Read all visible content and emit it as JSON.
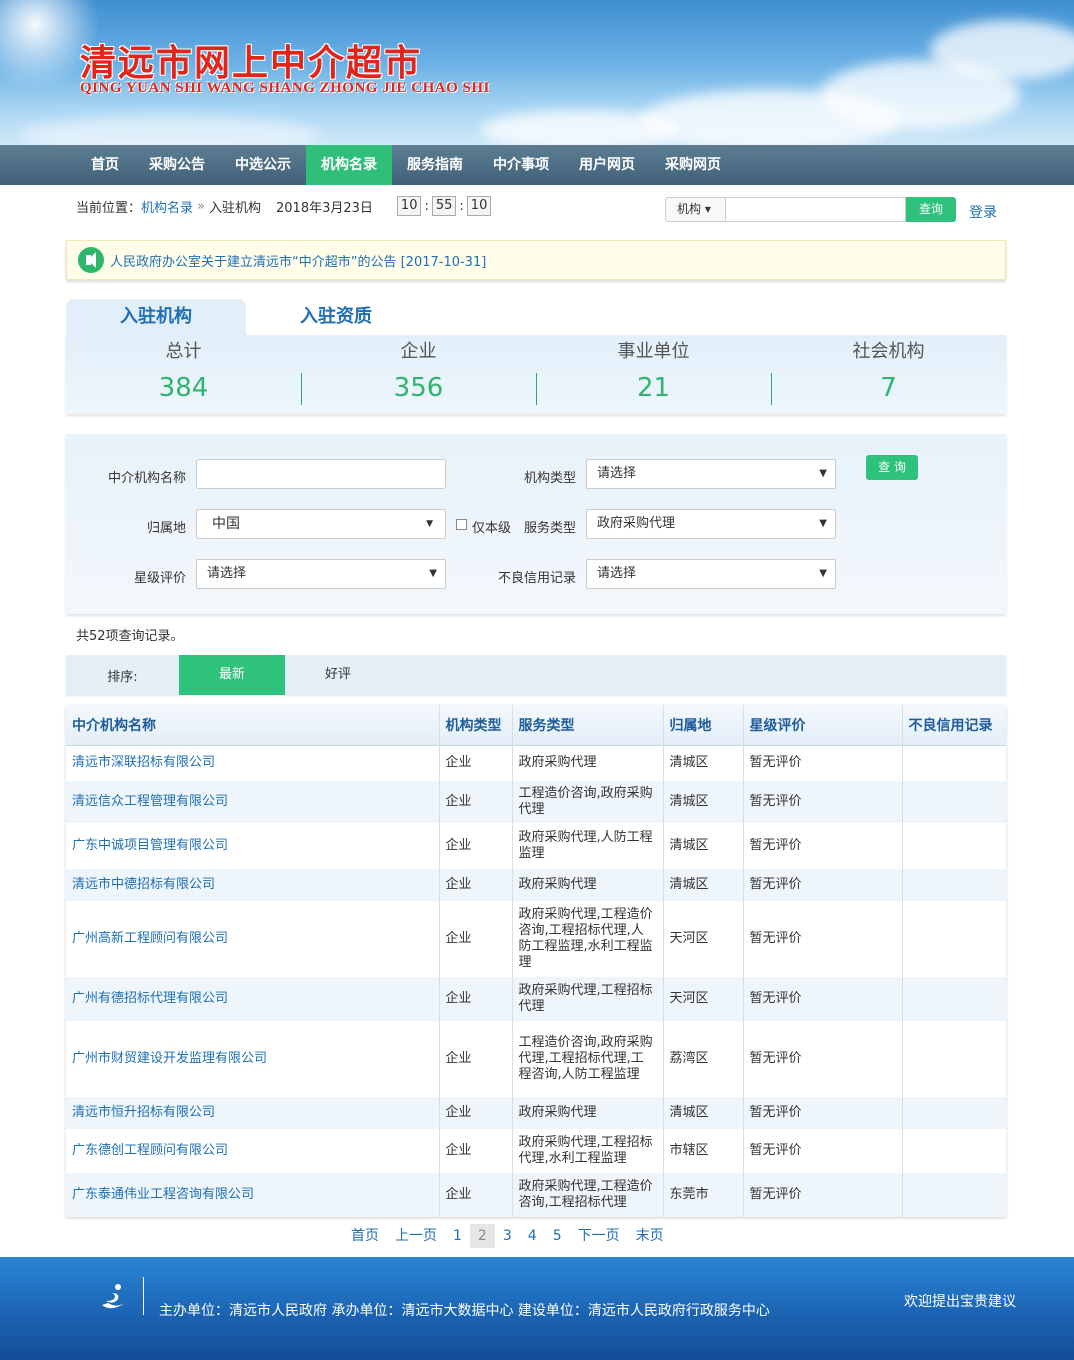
{
  "header": {
    "title": "清远市网上中介超市",
    "subtitle": "QING YUAN SHI WANG SHANG ZHONG JIE CHAO SHI"
  },
  "nav": [
    {
      "label": "首页",
      "active": false
    },
    {
      "label": "采购公告",
      "active": false
    },
    {
      "label": "中选公示",
      "active": false
    },
    {
      "label": "机构名录",
      "active": true
    },
    {
      "label": "服务指南",
      "active": false
    },
    {
      "label": "中介事项",
      "active": false
    },
    {
      "label": "用户网页",
      "active": false
    },
    {
      "label": "采购网页",
      "active": false
    }
  ],
  "breadcrumb": {
    "prefix": "当前位置：",
    "link": "机构名录",
    "sep": "»",
    "current": "入驻机构",
    "date": "2018年3月23日",
    "clock": {
      "h": "10",
      "m": "55",
      "s": "10"
    }
  },
  "search": {
    "type_label": "机构",
    "caret": "▾",
    "button": "查询",
    "login": "登录"
  },
  "notice": {
    "text": "人民政府办公室关于建立清远市“中介超市”的公告 [2017-10-31]"
  },
  "tabs": [
    {
      "label": "入驻机构",
      "active": true
    },
    {
      "label": "入驻资质",
      "active": false
    }
  ],
  "stats": [
    {
      "label": "总计",
      "value": "384"
    },
    {
      "label": "企业",
      "value": "356"
    },
    {
      "label": "事业单位",
      "value": "21"
    },
    {
      "label": "社会机构",
      "value": "7"
    }
  ],
  "filter": {
    "name_label": "中介机构名称",
    "name_value": "",
    "type_label": "机构类型",
    "type_value": "请选择",
    "region_label": "归属地",
    "region_value": "中国",
    "only_level_label": "仅本级",
    "service_label": "服务类型",
    "service_value": "政府采购代理",
    "star_label": "星级评价",
    "star_value": "请选择",
    "credit_label": "不良信用记录",
    "credit_value": "请选择",
    "query_button": "查 询",
    "arrow": "▼"
  },
  "result_count": "共52项查询记录。",
  "sort": {
    "label": "排序:",
    "options": [
      {
        "label": "最新",
        "active": true
      },
      {
        "label": "好评",
        "active": false
      }
    ]
  },
  "table": {
    "headers": [
      "中介机构名称",
      "机构类型",
      "服务类型",
      "归属地",
      "星级评价",
      "不良信用记录"
    ],
    "rows": [
      [
        "清远市深联招标有限公司",
        "企业",
        "政府采购代理",
        "清城区",
        "暂无评价",
        ""
      ],
      [
        "清远信众工程管理有限公司",
        "企业",
        "工程造价咨询,政府采购代理",
        "清城区",
        "暂无评价",
        ""
      ],
      [
        "广东中诚项目管理有限公司",
        "企业",
        "政府采购代理,人防工程监理",
        "清城区",
        "暂无评价",
        ""
      ],
      [
        "清远市中德招标有限公司",
        "企业",
        "政府采购代理",
        "清城区",
        "暂无评价",
        ""
      ],
      [
        "广州高新工程顾问有限公司",
        "企业",
        "政府采购代理,工程造价咨询,工程招标代理,人防工程监理,水利工程监理",
        "天河区",
        "暂无评价",
        ""
      ],
      [
        "广州有德招标代理有限公司",
        "企业",
        "政府采购代理,工程招标代理",
        "天河区",
        "暂无评价",
        ""
      ],
      [
        "广州市财贸建设开发监理有限公司",
        "企业",
        "工程造价咨询,政府采购代理,工程招标代理,工程咨询,人防工程监理",
        "荔湾区",
        "暂无评价",
        ""
      ],
      [
        "清远市恒升招标有限公司",
        "企业",
        "政府采购代理",
        "清城区",
        "暂无评价",
        ""
      ],
      [
        "广东德创工程顾问有限公司",
        "企业",
        "政府采购代理,工程招标代理,水利工程监理",
        "市辖区",
        "暂无评价",
        ""
      ],
      [
        "广东泰通伟业工程咨询有限公司",
        "企业",
        "政府采购代理,工程造价咨询,工程招标代理",
        "东莞市",
        "暂无评价",
        ""
      ]
    ]
  },
  "pager": [
    {
      "label": "首页",
      "current": false
    },
    {
      "label": "上一页",
      "current": false
    },
    {
      "label": "1",
      "current": false
    },
    {
      "label": "2",
      "current": true
    },
    {
      "label": "3",
      "current": false
    },
    {
      "label": "4",
      "current": false
    },
    {
      "label": "5",
      "current": false
    },
    {
      "label": "下一页",
      "current": false
    },
    {
      "label": "末页",
      "current": false
    }
  ],
  "footer": {
    "text": "主办单位：清远市人民政府 承办单位：清远市大数据中心 建设单位：清远市人民政府行政服务中心",
    "right": "欢迎提出宝贵建议"
  }
}
